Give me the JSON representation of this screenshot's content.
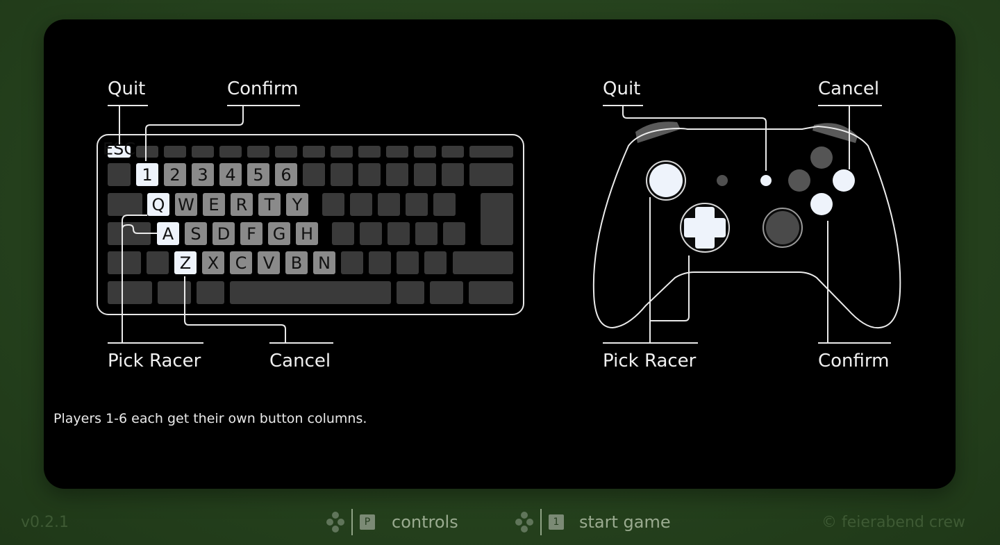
{
  "keyboard": {
    "labels": {
      "quit": "Quit",
      "confirm": "Confirm",
      "pick_racer": "Pick Racer",
      "cancel": "Cancel"
    },
    "esc_key": "ESC",
    "number_keys": [
      "1",
      "2",
      "3",
      "4",
      "5",
      "6"
    ],
    "row_q": [
      "Q",
      "W",
      "E",
      "R",
      "T",
      "Y"
    ],
    "row_a": [
      "A",
      "S",
      "D",
      "F",
      "G",
      "H"
    ],
    "row_z": [
      "Z",
      "X",
      "C",
      "V",
      "B",
      "N"
    ]
  },
  "gamepad": {
    "labels": {
      "quit": "Quit",
      "cancel": "Cancel",
      "pick_racer": "Pick Racer",
      "confirm": "Confirm"
    }
  },
  "note": "Players 1-6 each get their own button columns.",
  "footer": {
    "version": "v0.2.1",
    "hint_controls": {
      "key": "P",
      "label": "controls"
    },
    "hint_start": {
      "key": "1",
      "label": "start game"
    },
    "copyright": "© feierabend crew"
  },
  "colors": {
    "background": "#25411d",
    "panel": "#000000",
    "key_dark": "#3a3a3a",
    "key_mid": "#8a8a8a",
    "key_active": "#eef3fb",
    "stroke": "#ffffff"
  }
}
